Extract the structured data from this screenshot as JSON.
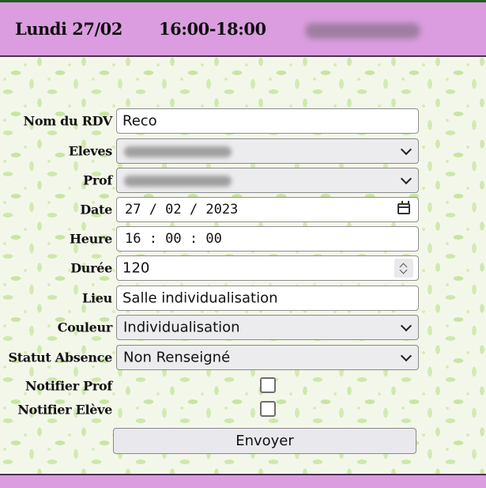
{
  "header": {
    "date": "Lundi 27/02",
    "time": "16:00-18:00"
  },
  "form": {
    "nom_rdv": {
      "label": "Nom du RDV",
      "value": "Reco"
    },
    "eleves": {
      "label": "Eleves"
    },
    "prof": {
      "label": "Prof"
    },
    "date": {
      "label": "Date",
      "value": "27 / 02 / 2023"
    },
    "heure": {
      "label": "Heure",
      "value": "16 : 00 : 00"
    },
    "duree": {
      "label": "Durée",
      "value": "120"
    },
    "lieu": {
      "label": "Lieu",
      "value": "Salle individualisation"
    },
    "couleur": {
      "label": "Couleur",
      "value": "Individualisation"
    },
    "statut_absence": {
      "label": "Statut Absence",
      "value": "Non Renseigné"
    },
    "notifier_prof": {
      "label": "Notifier Prof",
      "checked": false
    },
    "notifier_eleve": {
      "label": "Notifier Elève",
      "checked": false
    },
    "submit_label": "Envoyer"
  },
  "colors": {
    "header_bg": "#dc9de0",
    "pattern_leaf": "#c9e4a2",
    "pattern_bg": "#f3f7ea"
  },
  "icons": [
    "calendar-icon",
    "chevron-down-icon",
    "spinner-arrows-icon"
  ]
}
